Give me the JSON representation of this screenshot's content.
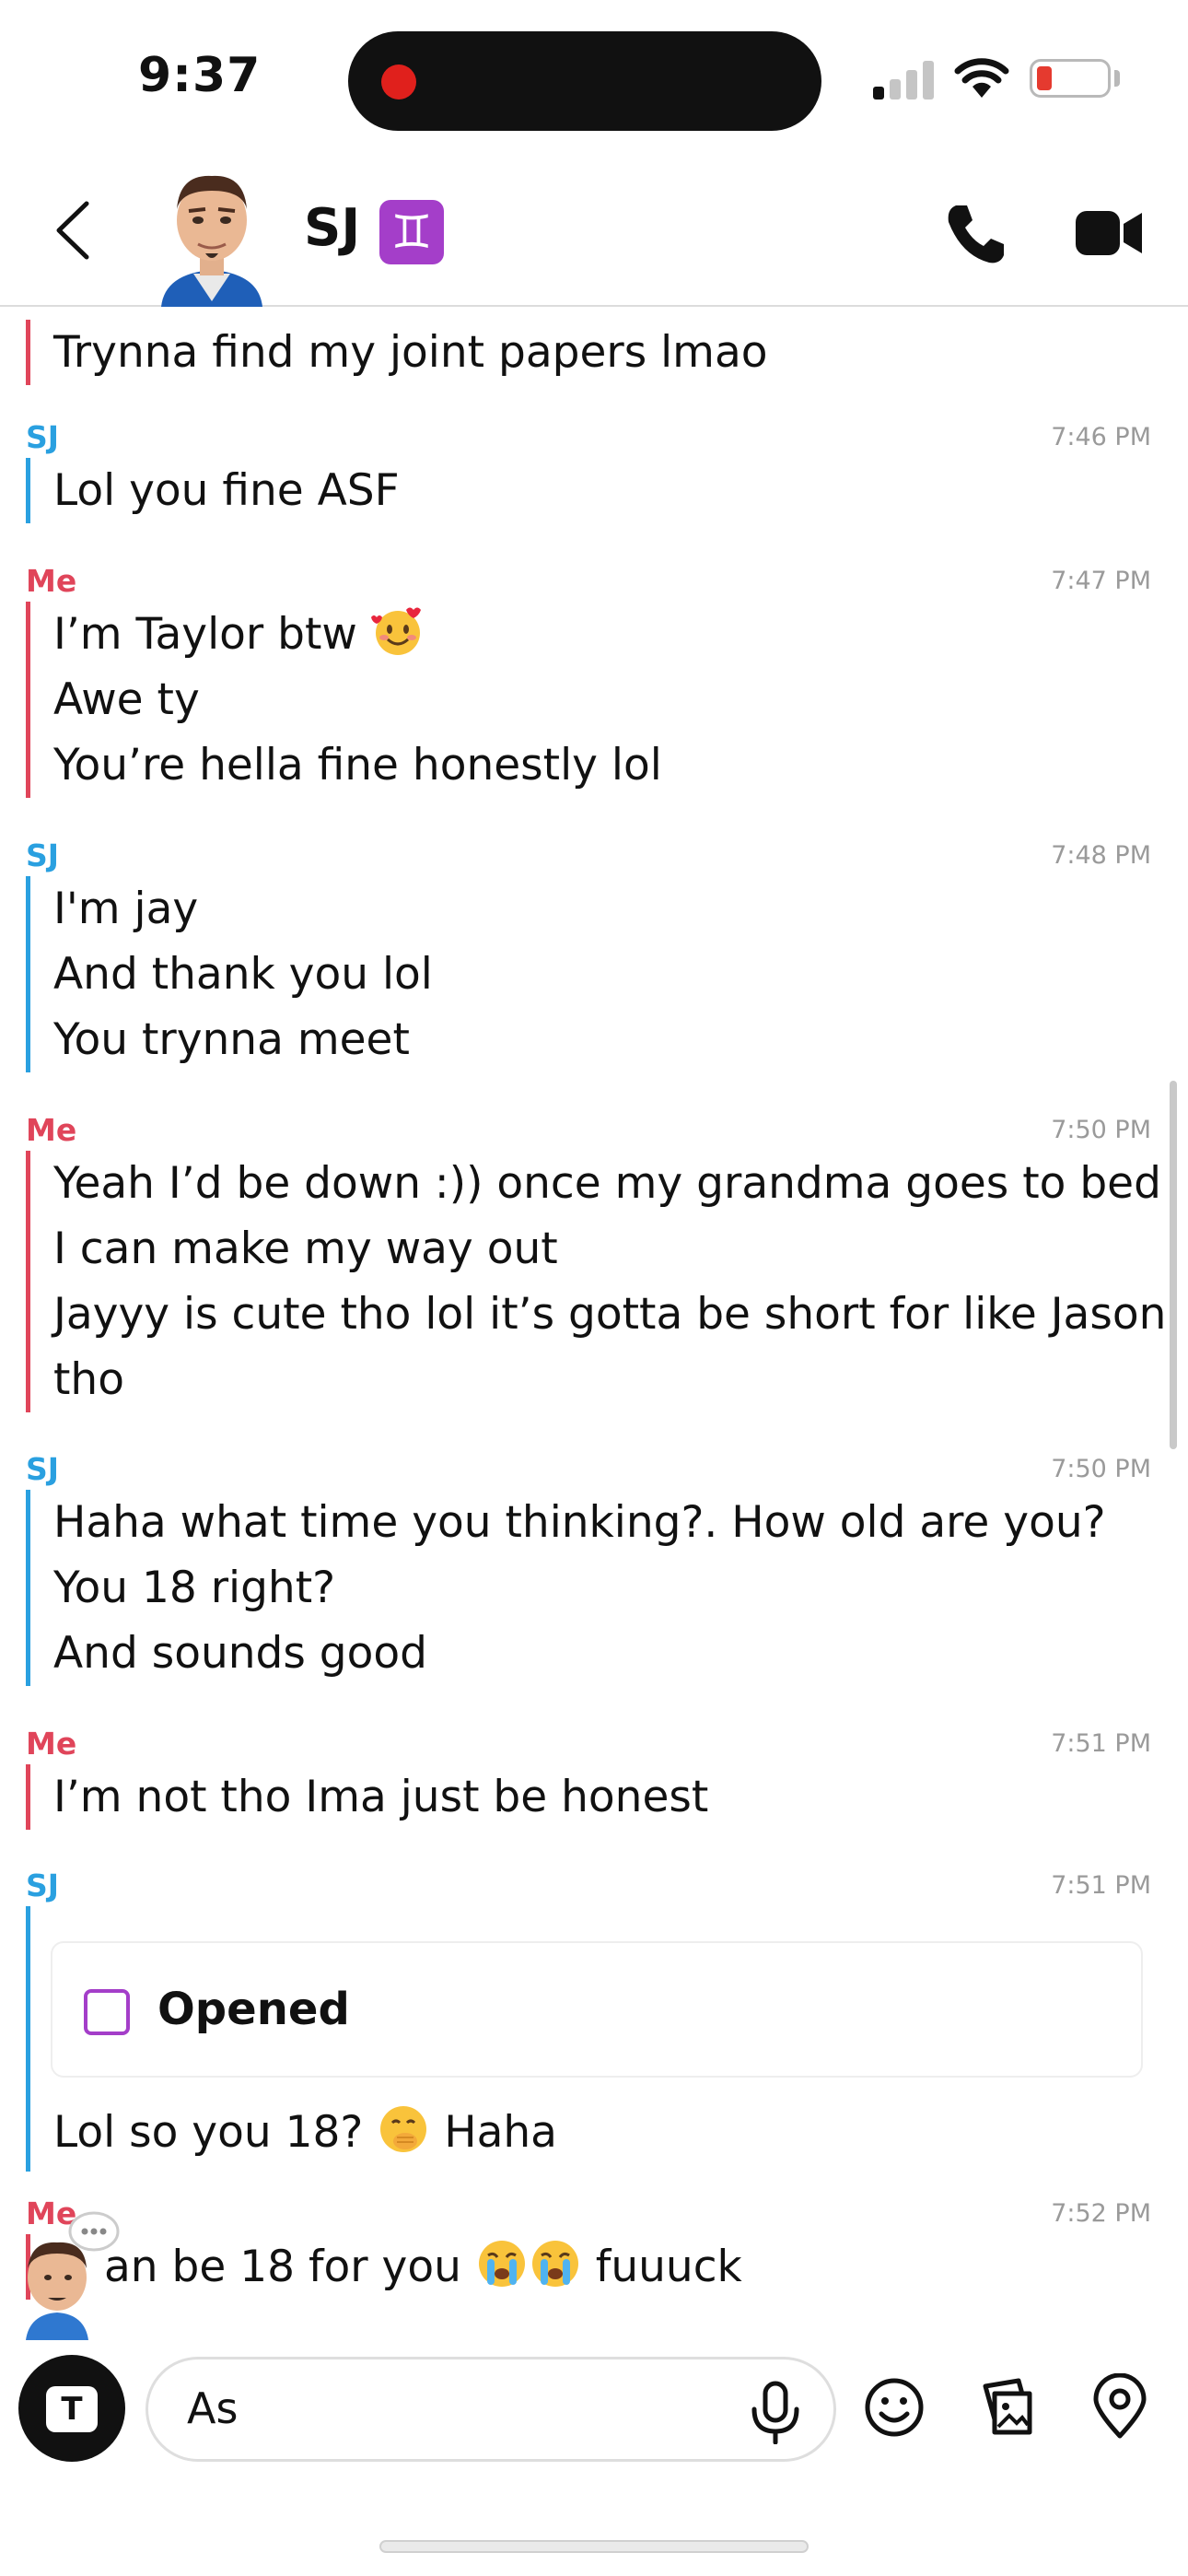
{
  "status_bar": {
    "time": "9:37"
  },
  "header": {
    "contact_name": "SJ",
    "zodiac_symbol": "♊"
  },
  "colors": {
    "me": "#e0455a",
    "sj": "#2aa0e0",
    "opened": "#a43ec9"
  },
  "messages": [
    {
      "sender": "",
      "time": "",
      "lines": [
        "Trynna find my joint papers lmao"
      ]
    },
    {
      "sender": "SJ",
      "time": "7:46 PM",
      "lines": [
        "Lol you fine ASF"
      ]
    },
    {
      "sender": "Me",
      "time": "7:47 PM",
      "lines": [
        "I’m Taylor btw",
        "Awe ty",
        "You’re hella fine honestly lol"
      ]
    },
    {
      "sender": "SJ",
      "time": "7:48 PM",
      "lines": [
        "I'm jay",
        "And thank you lol",
        "You trynna meet"
      ]
    },
    {
      "sender": "Me",
      "time": "7:50 PM",
      "lines": [
        "Yeah I’d be down :)) once my grandma goes to bed",
        "I can make my way out",
        "Jayyy is cute tho lol it’s gotta be short for like Jason",
        "tho"
      ]
    },
    {
      "sender": "SJ",
      "time": "7:50 PM",
      "lines": [
        "Haha what time you thinking?. How old are you?",
        "You 18 right?",
        "And sounds good"
      ]
    },
    {
      "sender": "Me",
      "time": "7:51 PM",
      "lines": [
        "I’m not tho Ima just be honest"
      ]
    },
    {
      "sender": "SJ",
      "time": "7:51 PM",
      "opened_label": "Opened",
      "lines": [
        "Lol so you 18?",
        "Haha"
      ]
    },
    {
      "sender": "Me",
      "time": "7:52 PM",
      "lines": [
        "an be 18 for you",
        "fuuuck"
      ]
    }
  ],
  "input": {
    "value": "As"
  },
  "icons": {
    "back": "chevron-left-icon",
    "call": "phone-icon",
    "video": "video-camera-icon",
    "mic": "microphone-icon",
    "smile": "smiley-icon",
    "stickers": "sticker-icon",
    "map": "location-pin-icon",
    "camera": "camera-icon"
  }
}
